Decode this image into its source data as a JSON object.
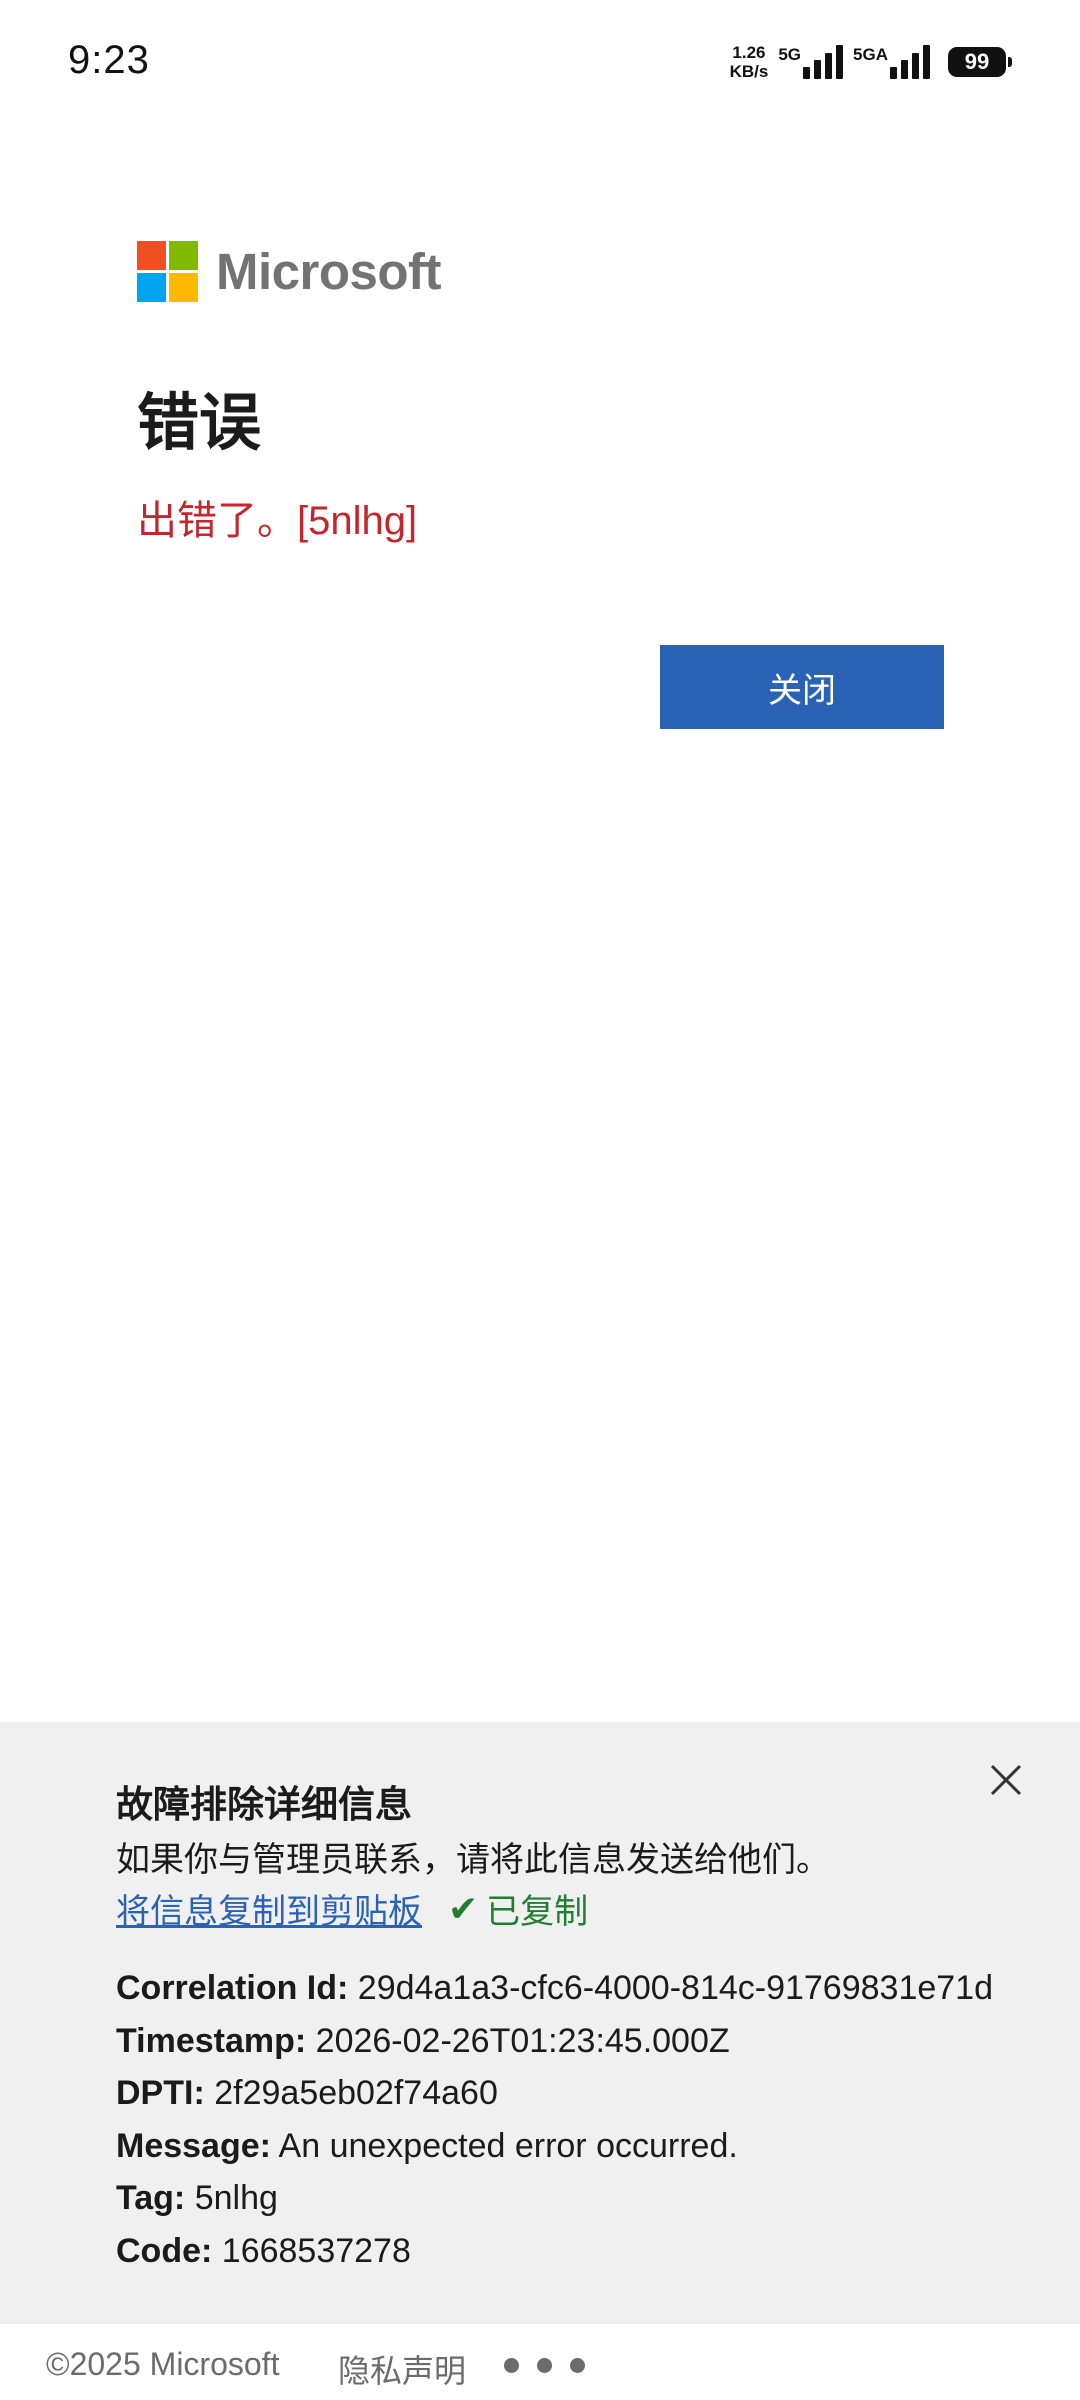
{
  "status_bar": {
    "time": "9:23",
    "net_speed_value": "1.26",
    "net_speed_unit": "KB/s",
    "sim1_label": "5G",
    "sim2_label": "5GA",
    "battery_level": "99"
  },
  "brand": {
    "name": "Microsoft",
    "colors": [
      "#f25022",
      "#7fba00",
      "#00a4ef",
      "#ffb900"
    ]
  },
  "error": {
    "title": "错误",
    "message": "出错了。[5nlhg]",
    "message_color": "#c4262e"
  },
  "actions": {
    "close_label": "关闭",
    "accent_color": "#2a62b5"
  },
  "troubleshooting": {
    "title": "故障排除详细信息",
    "subtitle": "如果你与管理员联系，请将此信息发送给他们。",
    "copy_link": "将信息复制到剪贴板",
    "copied_status": "已复制",
    "close_icon": "close-icon",
    "details": [
      {
        "key": "Correlation Id:",
        "value": "29d4a1a3-cfc6-4000-814c-91769831e71d"
      },
      {
        "key": "Timestamp:",
        "value": "2026-02-26T01:23:45.000Z"
      },
      {
        "key": "DPTI:",
        "value": "2f29a5eb02f74a60"
      },
      {
        "key": "Message:",
        "value": "An unexpected error occurred."
      },
      {
        "key": "Tag:",
        "value": "5nlhg"
      },
      {
        "key": "Code:",
        "value": "1668537278"
      }
    ]
  },
  "footer": {
    "copyright": "©2025 Microsoft",
    "privacy": "隐私声明",
    "more_icon": "more-dots-icon"
  }
}
